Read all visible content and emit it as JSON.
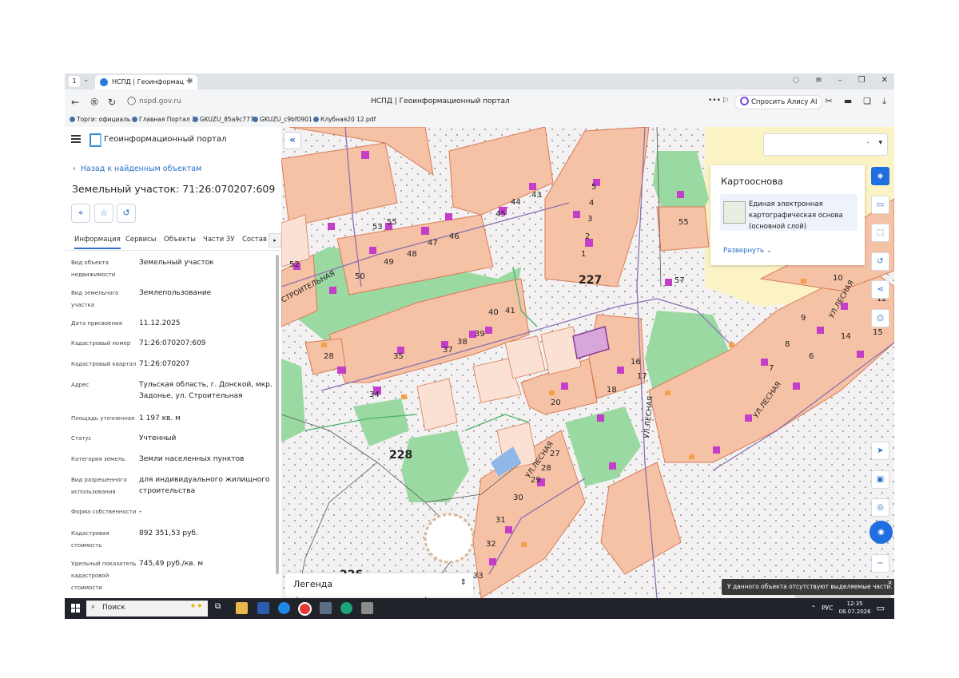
{
  "browser": {
    "tab_count": "1",
    "tab_title": "НСПД | Геоинформационный портал",
    "url": "nspd.gov.ru",
    "page_title": "НСПД | Геоинформационный портал",
    "alisa_label": "Спросить Алису AI",
    "bookmarks": [
      "Торги: официаль",
      "Главная Портал З",
      "GKUZU_85a9c777",
      "GKUZU_c9bf0901",
      "Клубная20 12.pdf"
    ]
  },
  "panel": {
    "portal_title": "Геоинформационный портал",
    "back_label": "Назад к найденным объектам",
    "parcel_title": "Земельный участок: 71:26:070207:609",
    "tabs": [
      "Информация",
      "Сервисы",
      "Объекты",
      "Части ЗУ",
      "Состав"
    ],
    "rows": [
      {
        "k": "Вид объекта недвижимости",
        "v": "Земельный участок"
      },
      {
        "k": "Вид земельного участка",
        "v": "Землепользование"
      },
      {
        "k": "Дата присвоения",
        "v": "11.12.2025"
      },
      {
        "k": "Кадастровый номер",
        "v": "71:26:070207:609"
      },
      {
        "k": "Кадастровый квартал",
        "v": "71:26:070207"
      },
      {
        "k": "Адрес",
        "v": "Тульская область, г. Донской, мкр. Задонье, ул. Строительная"
      },
      {
        "k": "Площадь уточненная",
        "v": "1 197 кв. м"
      },
      {
        "k": "Статус",
        "v": "Учтенный"
      },
      {
        "k": "Категория земель",
        "v": "Земли населенных пунктов"
      },
      {
        "k": "Вид разрешенного использования",
        "v": "для индивидуального жилищного строительства"
      },
      {
        "k": "Форма собственности",
        "v": "-"
      },
      {
        "k": "Кадастровая стоимость",
        "v": "892 351,53 руб."
      },
      {
        "k": "Удельный показатель кадастровой стоимости",
        "v": "745,49 руб./кв. м"
      }
    ]
  },
  "map": {
    "search_value": "-",
    "basemap_panel": {
      "title": "Картооснова",
      "layer_name": "Единая электронная картографическая основа (основной слой)",
      "expand_label": "Развернуть"
    },
    "legend_label": "Легенда",
    "toast_text": "У данного объекта отсутствуют выделяемые части.",
    "quarters": [
      "227",
      "228",
      "226"
    ],
    "street_labels": [
      "СТРОИТЕЛЬНАЯ",
      "УЛ.ЛЕСНАЯ",
      "УЛ.ЛЕСНАЯ",
      "УЛ.ЛЕСНАЯ",
      "УЛ.ЛЕСНАЯ"
    ],
    "house_numbers": [
      "53",
      "55",
      "45",
      "44",
      "43",
      "52",
      "50",
      "49",
      "48",
      "47",
      "46",
      "40",
      "41",
      "35",
      "37",
      "38",
      "39",
      "28",
      "34",
      "20",
      "18",
      "16",
      "17",
      "31",
      "30",
      "29",
      "28",
      "27",
      "32",
      "33",
      "57",
      "55",
      "1",
      "2",
      "3",
      "4",
      "5",
      "6",
      "7",
      "8",
      "9",
      "10",
      "12",
      "14",
      "15"
    ]
  },
  "taskbar": {
    "search_label": "Поиск",
    "lang": "РУС",
    "time": "12:35",
    "date": "08.07.2026"
  },
  "colors": {
    "parcel_fill": "#f6c2a6",
    "parcel_stroke": "#d97a55",
    "green": "#9bd9a2",
    "building": "#c33ec9",
    "accent": "#1f6fe0"
  }
}
